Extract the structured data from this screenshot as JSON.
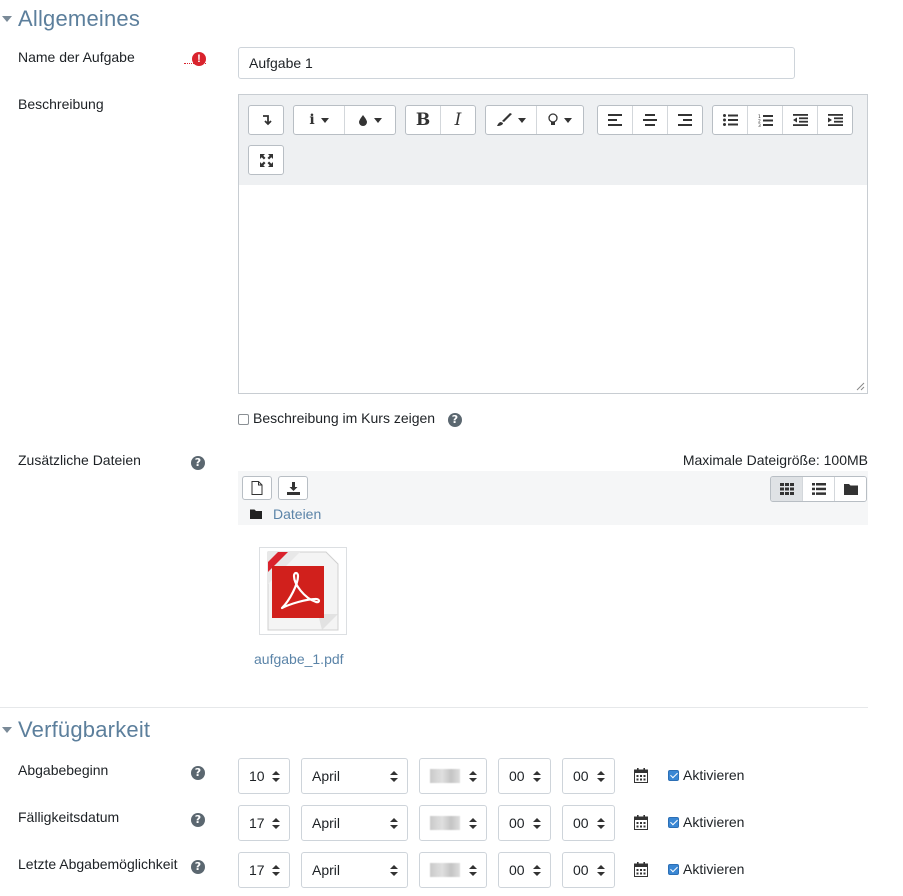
{
  "general": {
    "section_title": "Allgemeines",
    "name_label": "Name der Aufgabe",
    "name_value": "Aufgabe 1",
    "description_label": "Beschreibung",
    "show_description_label": "Beschreibung im Kurs zeigen",
    "additional_files_label": "Zusätzliche Dateien",
    "max_file_size": "Maximale Dateigröße: 100MB",
    "folder_label": "Dateien",
    "file_name": "aufgabe_1.pdf"
  },
  "editor_toolbar": {
    "icons": [
      "collapse-icon",
      "paragraph-style-icon",
      "text-color-icon",
      "bold-icon",
      "italic-icon",
      "paintbrush-icon",
      "lightbulb-icon",
      "align-left-icon",
      "align-center-icon",
      "align-right-icon",
      "unordered-list-icon",
      "ordered-list-icon",
      "outdent-icon",
      "indent-icon",
      "fullscreen-icon"
    ],
    "bold": "B",
    "italic": "I"
  },
  "availability": {
    "section_title": "Verfügbarkeit",
    "enable_label": "Aktivieren",
    "rows": [
      {
        "label": "Abgabebeginn",
        "day": "10",
        "month": "April",
        "hour": "00",
        "minute": "00",
        "enabled": true
      },
      {
        "label": "Fälligkeitsdatum",
        "day": "17",
        "month": "April",
        "hour": "00",
        "minute": "00",
        "enabled": true
      },
      {
        "label": "Letzte Abgabemöglichkeit",
        "day": "17",
        "month": "April",
        "hour": "00",
        "minute": "00",
        "enabled": true
      }
    ]
  },
  "colors": {
    "section_title": "#5c7f9c",
    "required": "#d9232d",
    "link": "#5b84a8",
    "checkbox_checked": "#3a87d4"
  }
}
